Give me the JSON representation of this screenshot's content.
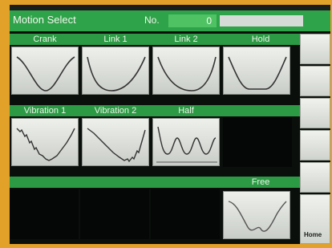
{
  "header": {
    "title": "Motion Select",
    "no_label": "No.",
    "no_value": "0"
  },
  "categories_row1": [
    "Crank",
    "Link 1",
    "Link 2",
    "Hold"
  ],
  "categories_row2": [
    "Vibration 1",
    "Vibration 2",
    "Half"
  ],
  "categories_row3": [
    "Free"
  ],
  "side": {
    "home_label": "Home"
  },
  "colors": {
    "header_green": "#2fa34a",
    "tile_gray": "#dde0db",
    "frame_orange": "#e2a128"
  }
}
